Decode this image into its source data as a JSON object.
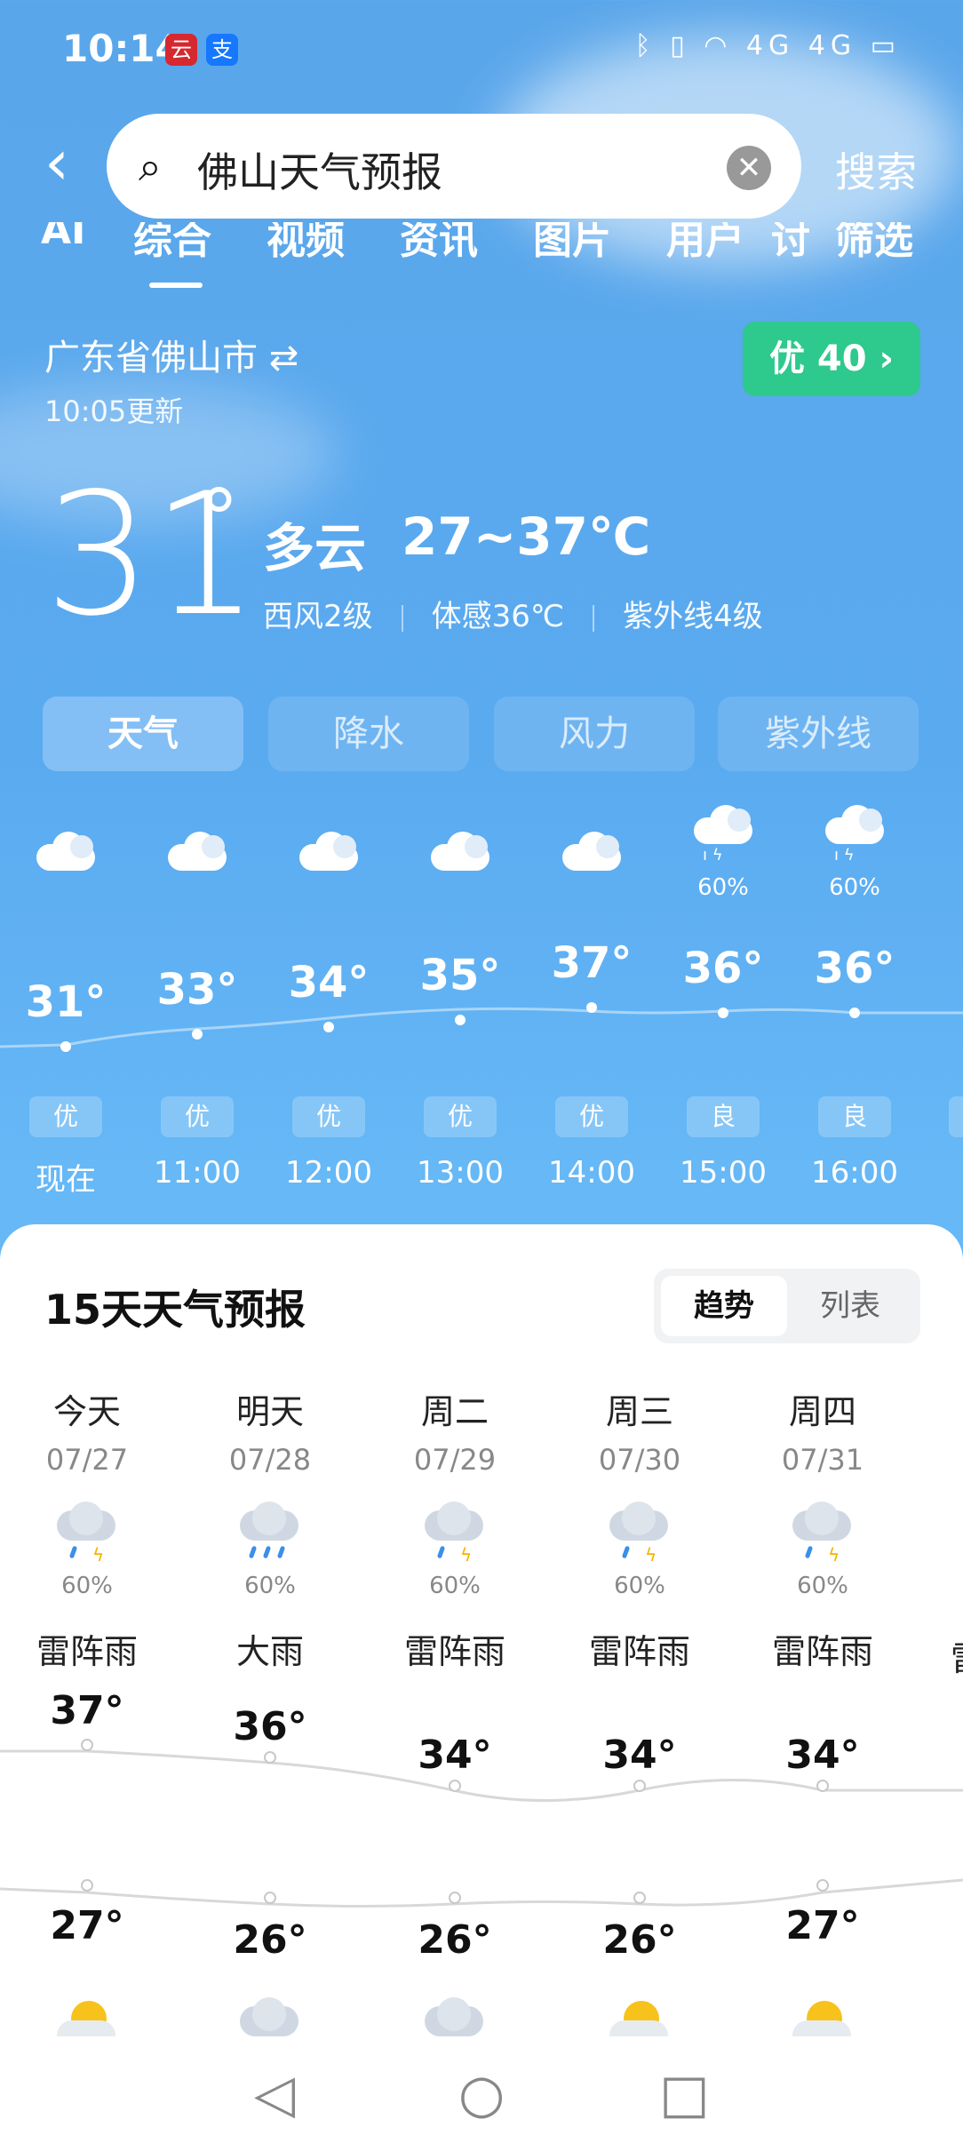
{
  "status": {
    "time": "10:14",
    "apps": [
      "云",
      "支"
    ],
    "right_icons": "ᛒ ▯ ◠ 4G 4G ▭"
  },
  "search": {
    "query": "佛山天气预报",
    "button": "搜索"
  },
  "tabs": [
    "AI",
    "综合",
    "视频",
    "资讯",
    "图片",
    "用户",
    "讨",
    "筛选"
  ],
  "location": {
    "city": "广东省佛山市",
    "swap_icon": "⇄",
    "updated": "10:05更新",
    "aqi_label": "优 40 ›"
  },
  "current": {
    "temp": "31",
    "deg": "°",
    "condition": "多云",
    "range": "27~37℃",
    "wind": "西风2级",
    "feels": "体感36℃",
    "uv": "紫外线4级"
  },
  "segments": [
    "天气",
    "降水",
    "风力",
    "紫外线"
  ],
  "hourly": [
    {
      "time": "现在",
      "temp": "31°",
      "aqi": "优",
      "icon": "cloudy",
      "pct": ""
    },
    {
      "time": "11:00",
      "temp": "33°",
      "aqi": "优",
      "icon": "cloudy",
      "pct": ""
    },
    {
      "time": "12:00",
      "temp": "34°",
      "aqi": "优",
      "icon": "cloudy",
      "pct": ""
    },
    {
      "time": "13:00",
      "temp": "35°",
      "aqi": "优",
      "icon": "cloudy",
      "pct": ""
    },
    {
      "time": "14:00",
      "temp": "37°",
      "aqi": "优",
      "icon": "cloudy",
      "pct": ""
    },
    {
      "time": "15:00",
      "temp": "36°",
      "aqi": "良",
      "icon": "thunder-rain",
      "pct": "60%"
    },
    {
      "time": "16:00",
      "temp": "36°",
      "aqi": "良",
      "icon": "thunder-rain",
      "pct": "60%"
    }
  ],
  "forecast": {
    "title": "15天天气预报",
    "toggle": [
      "趋势",
      "列表"
    ],
    "days": [
      {
        "name": "今天",
        "date": "07/27",
        "pct": "60%",
        "cond": "雷阵雨",
        "high": "37°",
        "low": "27°"
      },
      {
        "name": "明天",
        "date": "07/28",
        "pct": "60%",
        "cond": "大雨",
        "high": "36°",
        "low": "26°"
      },
      {
        "name": "周二",
        "date": "07/29",
        "pct": "60%",
        "cond": "雷阵雨",
        "high": "34°",
        "low": "26°"
      },
      {
        "name": "周三",
        "date": "07/30",
        "pct": "60%",
        "cond": "雷阵雨",
        "high": "34°",
        "low": "26°"
      },
      {
        "name": "周四",
        "date": "07/31",
        "pct": "60%",
        "cond": "雷阵雨",
        "high": "34°",
        "low": "27°"
      }
    ]
  },
  "nav": {
    "back": "◁",
    "home": "○",
    "recent": "□"
  }
}
